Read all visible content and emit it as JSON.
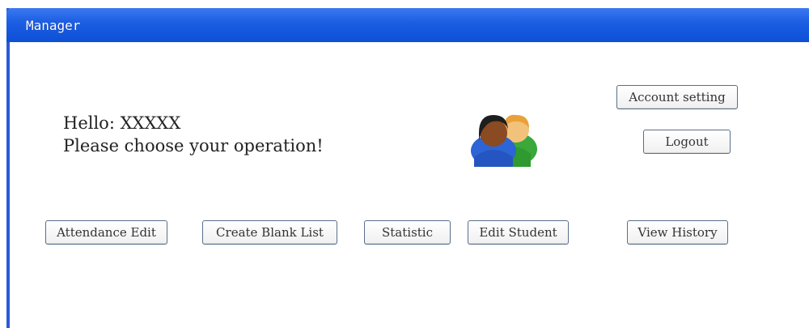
{
  "window": {
    "title": "Manager"
  },
  "greeting": {
    "line1": "Hello: XXXXX",
    "line2": "Please choose your operation!"
  },
  "icons": {
    "users": "users-icon"
  },
  "buttons": {
    "account_setting": "Account setting",
    "logout": "Logout",
    "attendance_edit": "Attendance Edit",
    "create_blank_list": "Create Blank List",
    "statistic": "Statistic",
    "edit_student": "Edit Student",
    "view_history": "View History"
  },
  "colors": {
    "titlebar": "#1d5fe3",
    "button_border": "#5a6f8a"
  }
}
